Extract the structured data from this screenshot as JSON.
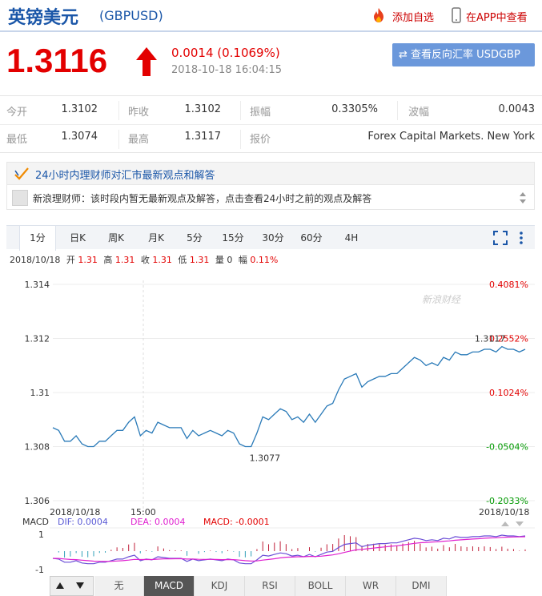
{
  "header": {
    "title": "英镑美元",
    "code": "(GBPUSD)",
    "add_watchlist": "添加自选",
    "view_in_app": "在APP中查看"
  },
  "quote": {
    "price": "1.3116",
    "change": "0.0014 (0.1069%)",
    "time": "2018-10-18 16:04:15",
    "reverse_button": "查看反向汇率 USDGBP"
  },
  "stats": {
    "open_label": "今开",
    "open_value": "1.3102",
    "prev_close_label": "昨收",
    "prev_close_value": "1.3102",
    "amplitude_label": "振幅",
    "amplitude_value": "0.3305%",
    "range_label": "波幅",
    "range_value": "0.0043",
    "low_label": "最低",
    "low_value": "1.3074",
    "high_label": "最高",
    "high_value": "1.3117",
    "quote_label": "报价",
    "quote_value": "Forex Capital Markets. New York"
  },
  "advisor": {
    "title": "24小时内理财师对汇市最新观点和解答",
    "message": "新浪理财师：该时段内暂无最新观点及解答，点击查看24小时之前的观点及解答"
  },
  "chart_tabs": [
    "1分",
    "日K",
    "周K",
    "月K",
    "5分",
    "15分",
    "30分",
    "60分",
    "4H"
  ],
  "info_bar": {
    "date": "2018/10/18",
    "open_label": "开",
    "open_value": "1.31",
    "high_label": "高",
    "high_value": "1.31",
    "close_label": "收",
    "close_value": "1.31",
    "low_label": "低",
    "low_value": "1.31",
    "volume_label": "量",
    "volume_value": "0",
    "pct_label": "幅",
    "pct_value": "0.11%"
  },
  "watermark": "新浪财经",
  "macd": {
    "label": "MACD",
    "dif": "DIF: 0.0004",
    "dea": "DEA: 0.0004",
    "macd": "MACD: -0.0001",
    "ylabels": [
      "1",
      "-1"
    ]
  },
  "indicator_tabs": [
    "无",
    "MACD",
    "KDJ",
    "RSI",
    "BOLL",
    "WR",
    "DMI"
  ],
  "colors": {
    "up": "#e30000",
    "down": "#009900",
    "line": "#2a7ab8",
    "brand": "#1a56a8"
  },
  "chart_data": {
    "type": "line",
    "ylim": [
      1.306,
      1.314
    ],
    "y_ticks": [
      "1.314",
      "1.312",
      "1.31",
      "1.308",
      "1.306"
    ],
    "pct_ticks": [
      "0.4081%",
      "0.2552%",
      "0.1024%",
      "-0.0504%",
      "-0.2033%"
    ],
    "x_labels": [
      "2018/10/18",
      "15:00",
      "2018/10/18"
    ],
    "annotations": {
      "high": "1.3117",
      "low": "1.3077"
    },
    "series": [
      {
        "values": [
          1.3087,
          1.3086,
          1.3082,
          1.3082,
          1.3084,
          1.3081,
          1.308,
          1.308,
          1.3082,
          1.3082,
          1.3084,
          1.3086,
          1.3086,
          1.3089,
          1.3091,
          1.3084,
          1.3086,
          1.3085,
          1.3089,
          1.3088,
          1.3087,
          1.3087,
          1.3087,
          1.3083,
          1.3086,
          1.3084,
          1.3085,
          1.3086,
          1.3085,
          1.3084,
          1.3086,
          1.3085,
          1.3081,
          1.308,
          1.308,
          1.3085,
          1.3091,
          1.309,
          1.3092,
          1.3094,
          1.3093,
          1.309,
          1.3091,
          1.3089,
          1.3092,
          1.3089,
          1.3092,
          1.3095,
          1.3096,
          1.3101,
          1.3105,
          1.3106,
          1.3107,
          1.3102,
          1.3104,
          1.3105,
          1.3106,
          1.3106,
          1.3107,
          1.3107,
          1.3109,
          1.3111,
          1.3113,
          1.3112,
          1.311,
          1.3111,
          1.311,
          1.3113,
          1.3112,
          1.3115,
          1.3114,
          1.3114,
          1.3115,
          1.3115,
          1.3116,
          1.3116,
          1.3115,
          1.3117,
          1.3116,
          1.3116,
          1.3115,
          1.3116
        ]
      }
    ]
  }
}
